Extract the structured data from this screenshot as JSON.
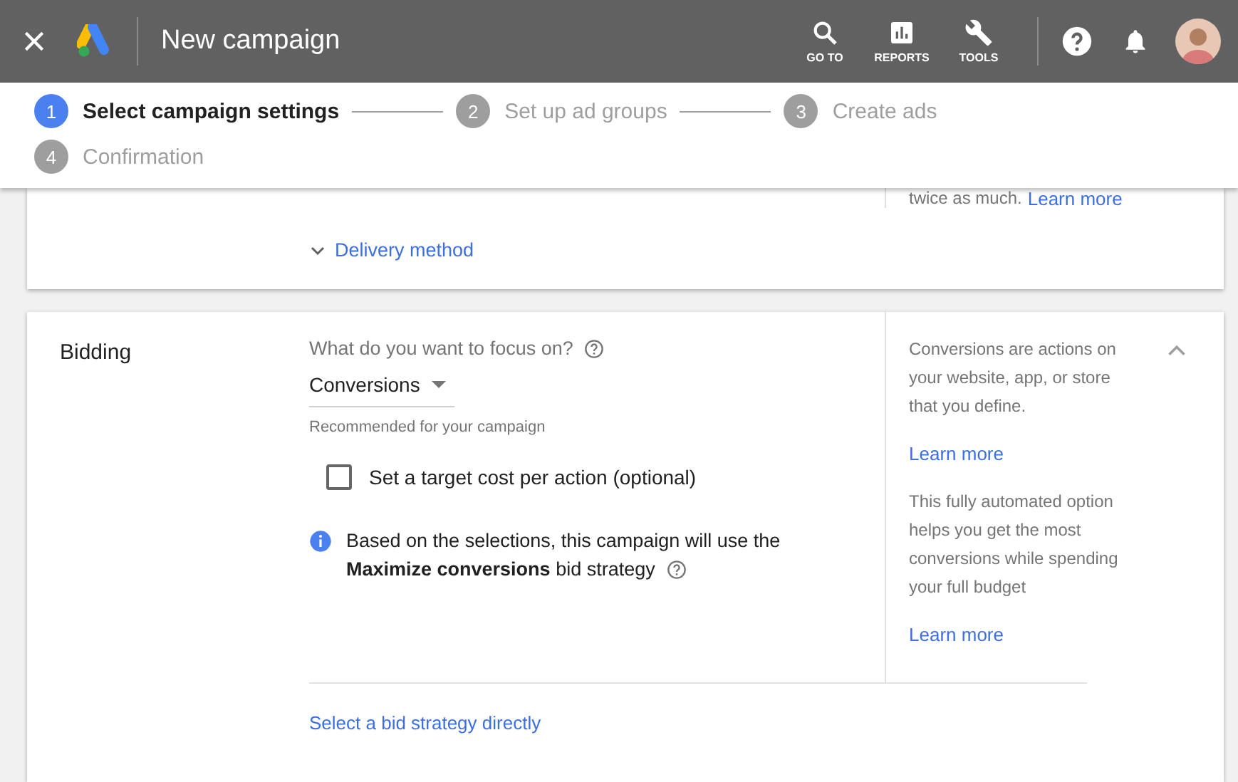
{
  "header": {
    "title": "New campaign",
    "actions": [
      {
        "kind": "search",
        "label": "GO TO"
      },
      {
        "kind": "reports",
        "label": "REPORTS"
      },
      {
        "kind": "tools",
        "label": "TOOLS"
      }
    ]
  },
  "stepper": {
    "steps": [
      {
        "number": "1",
        "label": "Select campaign settings",
        "selected": true
      },
      {
        "number": "2",
        "label": "Set up ad groups",
        "selected": false
      },
      {
        "number": "3",
        "label": "Create ads",
        "selected": false
      },
      {
        "number": "4",
        "label": "Confirmation",
        "selected": false
      }
    ]
  },
  "delivery_card": {
    "note": "twice as much.",
    "note_link": "Learn more",
    "toggle": "Delivery method",
    "expanded": false
  },
  "bidding": {
    "title": "Bidding",
    "expanded": true,
    "question": "What do you want to focus on?",
    "dropdown": "Conversions",
    "hint": "Recommended for your campaign",
    "checkbox": {
      "label": "Set a target cost per action (optional)",
      "checked": false
    },
    "info": "Based on the selections, this campaign will use the **Maximize conversions** bid strategy",
    "link": "Select a bid strategy directly",
    "side": [
      {
        "kind": "text",
        "text": "Conversions are actions on your website, app, or store that you define."
      },
      {
        "kind": "link",
        "text": "Learn more"
      },
      {
        "kind": "text",
        "text": "This fully automated option helps you get the most conversions while spending your full budget"
      },
      {
        "kind": "link",
        "text": "Learn more"
      }
    ]
  }
}
